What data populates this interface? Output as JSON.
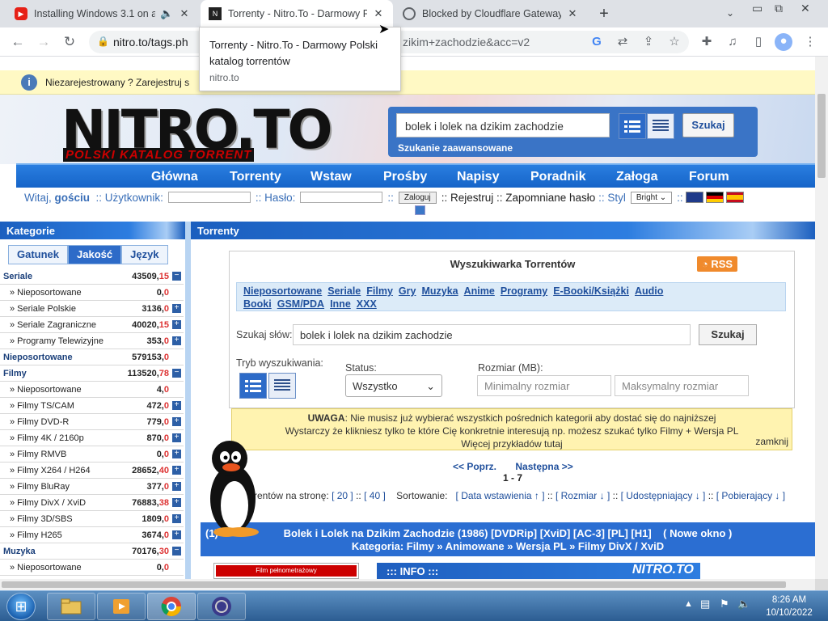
{
  "browser": {
    "tabs": [
      {
        "title": "Installing Windows 3.1 on an",
        "fav_color": "#e62117",
        "muted_icon": "🔈",
        "close": "✕"
      },
      {
        "title": "Torrenty - Nitro.To - Darmowy Po",
        "fav_color": "#222222",
        "close": "✕"
      },
      {
        "title": "Blocked by Cloudflare Gateway",
        "fav_color": "#5f6368",
        "close": "✕"
      }
    ],
    "new_tab": "+",
    "url_left": "nitro.to/tags.ph",
    "url_right": "zikim+zachodzie&acc=v2",
    "tooltip": {
      "title": "Torrenty - Nitro.To - Darmowy Polski katalog torrentów",
      "url": "nitro.to"
    }
  },
  "notice": {
    "text": "Niezarejestrowany ? Zarejestruj s",
    "icon": "i"
  },
  "logo": {
    "main": "NITRO.TO",
    "sub": "POLSKI KATALOG TORRENT"
  },
  "search": {
    "value": "bolek i lolek na dzikim zachodzie",
    "button": "Szukaj",
    "advanced": "Szukanie zaawansowane"
  },
  "nav": [
    "Główna",
    "Torrenty",
    "Wstaw",
    "Prośby",
    "Napisy",
    "Poradnik",
    "Załoga",
    "Forum"
  ],
  "login": {
    "welcome": "Witaj,",
    "guest": "gościu",
    "user_label": ":: Użytkownik:",
    "pass_label": ":: Hasło:",
    "sep": "::",
    "login_btn": "Zaloguj",
    "register": ":: Rejestruj",
    "forgot": ":: Zapomniane hasło",
    "style": ":: Styl",
    "style_value": "Bright",
    "sep2": "::"
  },
  "categories": {
    "head": "Kategorie",
    "tabs": [
      "Gatunek",
      "Jakość",
      "Język"
    ],
    "rows": [
      {
        "name": "Seriale",
        "count": "43509,",
        "new": "15",
        "main": true,
        "plus": "−"
      },
      {
        "name": "» Nieposortowane",
        "count": "0,",
        "new": "0",
        "main": false,
        "plus": ""
      },
      {
        "name": "» Seriale Polskie",
        "count": "3136,",
        "new": "0",
        "main": false,
        "plus": "+"
      },
      {
        "name": "» Seriale Zagraniczne",
        "count": "40020,",
        "new": "15",
        "main": false,
        "plus": "+"
      },
      {
        "name": "» Programy Telewizyjne",
        "count": "353,",
        "new": "0",
        "main": false,
        "plus": "+"
      },
      {
        "name": "Nieposortowane",
        "count": "579153,",
        "new": "0",
        "main": true,
        "plus": ""
      },
      {
        "name": "Filmy",
        "count": "113520,",
        "new": "78",
        "main": true,
        "plus": "−"
      },
      {
        "name": "» Nieposortowane",
        "count": "4,",
        "new": "0",
        "main": false,
        "plus": ""
      },
      {
        "name": "» Filmy TS/CAM",
        "count": "472,",
        "new": "0",
        "main": false,
        "plus": "+"
      },
      {
        "name": "» Filmy DVD-R",
        "count": "779,",
        "new": "0",
        "main": false,
        "plus": "+"
      },
      {
        "name": "» Filmy 4K / 2160p",
        "count": "870,",
        "new": "0",
        "main": false,
        "plus": "+"
      },
      {
        "name": "» Filmy RMVB",
        "count": "0,",
        "new": "0",
        "main": false,
        "plus": "+"
      },
      {
        "name": "» Filmy X264 / H264",
        "count": "28652,",
        "new": "40",
        "main": false,
        "plus": "+"
      },
      {
        "name": "» Filmy BluRay",
        "count": "377,",
        "new": "0",
        "main": false,
        "plus": "+"
      },
      {
        "name": "» Filmy DivX / XviD",
        "count": "76883,",
        "new": "38",
        "main": false,
        "plus": "+"
      },
      {
        "name": "» Filmy 3D/SBS",
        "count": "1809,",
        "new": "0",
        "main": false,
        "plus": "+"
      },
      {
        "name": "» Filmy H265",
        "count": "3674,",
        "new": "0",
        "main": false,
        "plus": "+"
      },
      {
        "name": "Muzyka",
        "count": "70176,",
        "new": "30",
        "main": true,
        "plus": "−"
      },
      {
        "name": "» Nieposortowane",
        "count": "0,",
        "new": "0",
        "main": false,
        "plus": ""
      }
    ]
  },
  "torrents": {
    "head": "Torrenty",
    "panel_title": "Wyszukiwarka Torrentów",
    "rss": "RSS",
    "cat_links": [
      "Nieposortowane",
      "Seriale",
      "Filmy",
      "Gry",
      "Muzyka",
      "Anime",
      "Programy",
      "E-Booki/Książki",
      "Audio Booki",
      "GSM/PDA",
      "Inne",
      "XXX"
    ],
    "words_label": "Szukaj słów:",
    "words_value": "bolek i lolek na dzikim zachodzie",
    "words_btn": "Szukaj",
    "mode_label": "Tryb wyszukiwania:",
    "status_label": "Status:",
    "status_value": "Wszystko",
    "size_label": "Rozmiar (MB):",
    "min_ph": "Minimalny rozmiar",
    "max_ph": "Maksymalny rozmiar",
    "uwaga_title": "UWAGA",
    "uwaga_1": ": Nie musisz już wybierać wszystkich pośrednich kategorii aby dostać się do najniższej",
    "uwaga_2": "Wystarczy że klikniesz tylko te które Cię konkretnie interesują np. możesz szukać tylko Filmy + Wersja PL",
    "uwaga_3": "Więcej przykładów tutaj",
    "close": "zamknij",
    "prev": "<< Poprz.",
    "next": "Następna >>",
    "range": "1 - 7",
    "per_page": "rrentów na stronę:",
    "pp20": "[ 20 ]",
    "pp_sep": "::",
    "pp40": "[ 40 ]",
    "sort_label": "Sortowanie:",
    "sort_opts": [
      "[ Data wstawienia ↑ ]",
      "::",
      "[ Rozmiar ↓ ]",
      "::",
      "[ Udostępniający ↓ ]",
      "::",
      "[ Pobierający ↓ ]"
    ],
    "result_num": "(1)",
    "result_title": "Bolek i Lolek na Dzikim Zachodzie (1986) [DVDRip] [XviD] [AC-3] [PL] [H1]",
    "result_new": "( Nowe okno )",
    "result_cat": "Kategoria: Filmy » Animowane » Wersja PL » Filmy DivX / XviD",
    "info": "::: INFO :::",
    "info_logo": "NITRO.TO",
    "poster_text": "Film pełnometrażowy"
  },
  "taskbar": {
    "time": "8:26 AM",
    "date": "10/10/2022"
  }
}
